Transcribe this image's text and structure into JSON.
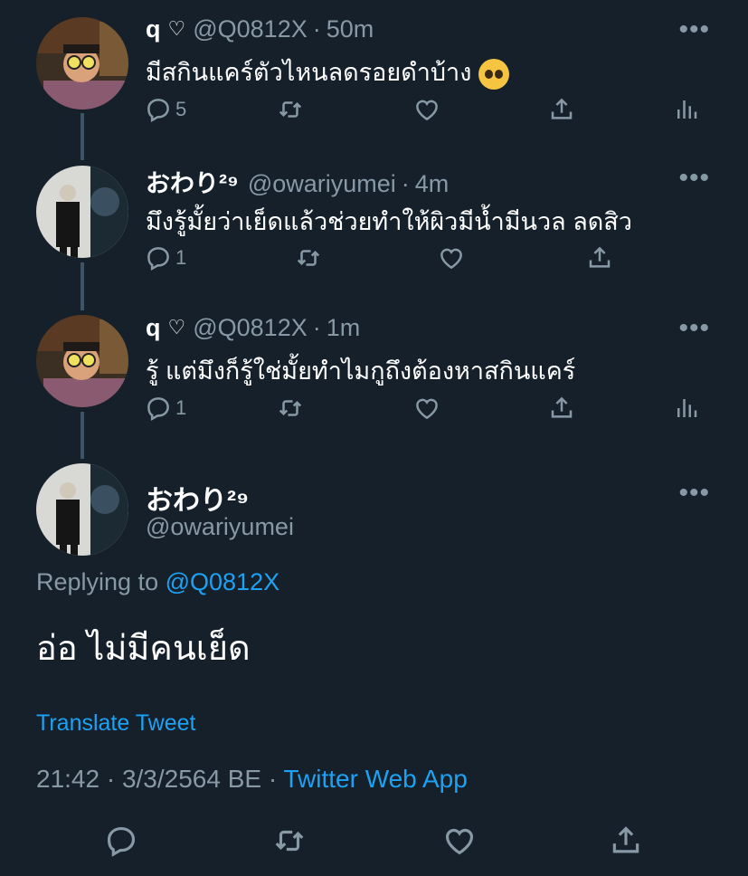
{
  "tweets": [
    {
      "name": "q",
      "name_icon": "heart-outline-icon",
      "handle": "@Q0812X",
      "time": "50m",
      "text": "มีสกินแคร์ตัวไหนลดรอยดำบ้าง",
      "emoji": "pleading-face-emoji",
      "reply_count": "5",
      "more": "•••"
    },
    {
      "name": "おわり²⁹",
      "handle": "@owariyumei",
      "time": "4m",
      "text": "มึงรู้มั้ยว่าเย็ดแล้วช่วยทำให้ผิวมีน้ำมีนวล ลดสิว",
      "reply_count": "1",
      "more": "•••"
    },
    {
      "name": "q",
      "name_icon": "heart-outline-icon",
      "handle": "@Q0812X",
      "time": "1m",
      "text": "รู้ แต่มึงก็รู้ใช่มั้ยทำไมกูถึงต้องหาสกินแคร์",
      "reply_count": "1",
      "more": "•••"
    }
  ],
  "main_tweet": {
    "name": "おわり²⁹",
    "handle": "@owariyumei",
    "replying_prefix": "Replying to",
    "replying_to": "@Q0812X",
    "text": "อ่อ ไม่มีคนเย็ด",
    "translate": "Translate Tweet",
    "timestamp": "21:42 · 3/3/2564 BE · ",
    "source": "Twitter Web App",
    "more": "•••"
  },
  "sep": "·",
  "heart_glyph": "♡",
  "colors": {
    "background": "#15202b",
    "secondary_text": "#8899a6",
    "accent": "#1da1f2",
    "thread_line": "#3d5466"
  }
}
